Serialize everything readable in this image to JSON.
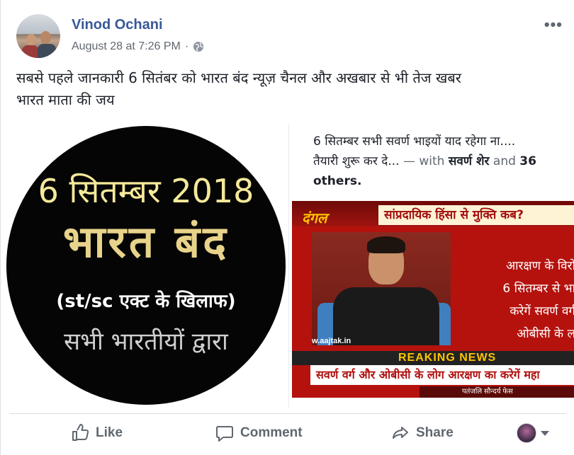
{
  "post": {
    "author": "Vinod Ochani",
    "timestamp": "August 28 at 7:26 PM",
    "separator": "·",
    "privacy_icon": "globe-icon",
    "more_label": "•••",
    "text_line1": "सबसे पहले जानकारी 6 सितंबर को भारत बंद न्यूज़ चैनल और अखबार से भी तेज खबर",
    "text_line2": "भारत माता की जय"
  },
  "poster": {
    "line1": "6 सितम्बर 2018",
    "line2": "भारत बंद",
    "line3": "(st/sc एक्ट के खिलाफ)",
    "line4": "सभी भारतीयों द्वारा"
  },
  "shared": {
    "caption_line1": "6 सितम्बर सभी सवर्ण भाइयों याद रहेगा ना....",
    "caption_line2_text": "तैयारी शुरू कर दे...",
    "caption_line2_with": " — with ",
    "caption_line2_tag": "सवर्ण शेर",
    "caption_line2_and": " and ",
    "caption_line2_count": "36",
    "caption_line3": "others.",
    "tv": {
      "show": "दंगल",
      "topic": "सांप्रदायिक हिंसा से मुक्ति कब?",
      "side_1": "आरक्षण के विरो",
      "side_2": "6 सितम्बर से भा",
      "side_3": "करेगें सवर्ण वर्ग",
      "side_4": "ओबीसी के ल",
      "site": "w.aajtak.in",
      "breaking": "REAKING NEWS",
      "ticker": "सवर्ण वर्ग और ओबीसी के लोग आरक्षण का करेगें महा",
      "ad": "पतंजलि सौन्दर्य फेस"
    }
  },
  "actions": {
    "like": "Like",
    "comment": "Comment",
    "share": "Share"
  }
}
